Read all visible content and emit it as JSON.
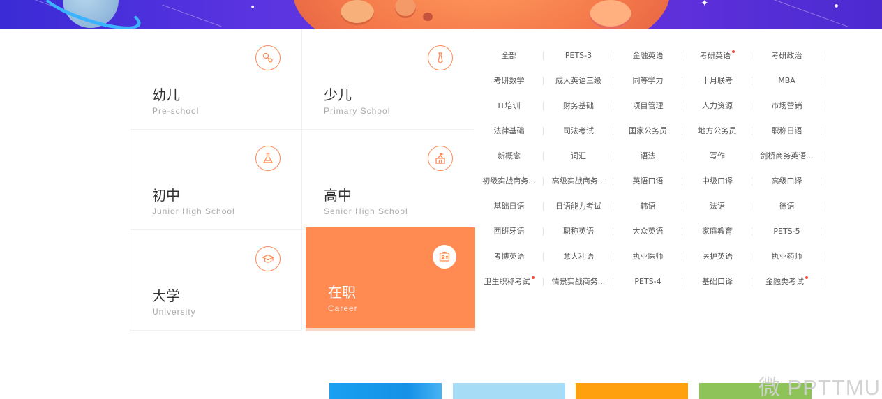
{
  "colors": {
    "accent": "#ff8a52",
    "icon_border": "#ff8a55",
    "hot_dot": "#f04e3e",
    "tile_blue": "#1aa0f0",
    "tile_lightblue": "#a7dcf6",
    "tile_orange": "#ffa10f",
    "tile_green": "#8ec35a"
  },
  "categories": [
    {
      "cn": "幼儿",
      "en": "Pre-school",
      "icon": "baby-rattle-icon"
    },
    {
      "cn": "少儿",
      "en": "Primary School",
      "icon": "necktie-icon"
    },
    {
      "cn": "初中",
      "en": "Junior High School",
      "icon": "flask-icon"
    },
    {
      "cn": "高中",
      "en": "Senior High School",
      "icon": "school-building-icon"
    },
    {
      "cn": "大学",
      "en": "University",
      "icon": "graduation-cap-icon"
    },
    {
      "cn": "在职",
      "en": "Career",
      "icon": "id-badge-icon",
      "selected": true
    }
  ],
  "subjects": [
    [
      "全部",
      "PETS-3",
      "金融英语",
      "考研英语",
      "考研政治"
    ],
    [
      "考研数学",
      "成人英语三级",
      "同等学力",
      "十月联考",
      "MBA"
    ],
    [
      "IT培训",
      "财务基础",
      "项目管理",
      "人力资源",
      "市场营销"
    ],
    [
      "法律基础",
      "司法考试",
      "国家公务员",
      "地方公务员",
      "职称日语"
    ],
    [
      "新概念",
      "词汇",
      "语法",
      "写作",
      "剑桥商务英语..."
    ],
    [
      "初级实战商务...",
      "高级实战商务...",
      "英语口语",
      "中级口译",
      "高级口译"
    ],
    [
      "基础日语",
      "日语能力考试",
      "韩语",
      "法语",
      "德语"
    ],
    [
      "西班牙语",
      "职称英语",
      "大众英语",
      "家庭教育",
      "PETS-5"
    ],
    [
      "考博英语",
      "意大利语",
      "执业医师",
      "医护英语",
      "执业药师"
    ],
    [
      "卫生职称考试",
      "情景实战商务...",
      "PETS-4",
      "基础口译",
      "金融类考试"
    ]
  ],
  "hot_subjects": [
    "考研英语",
    "卫生职称考试",
    "金融类考试"
  ],
  "watermark": "微 PPTTMU"
}
